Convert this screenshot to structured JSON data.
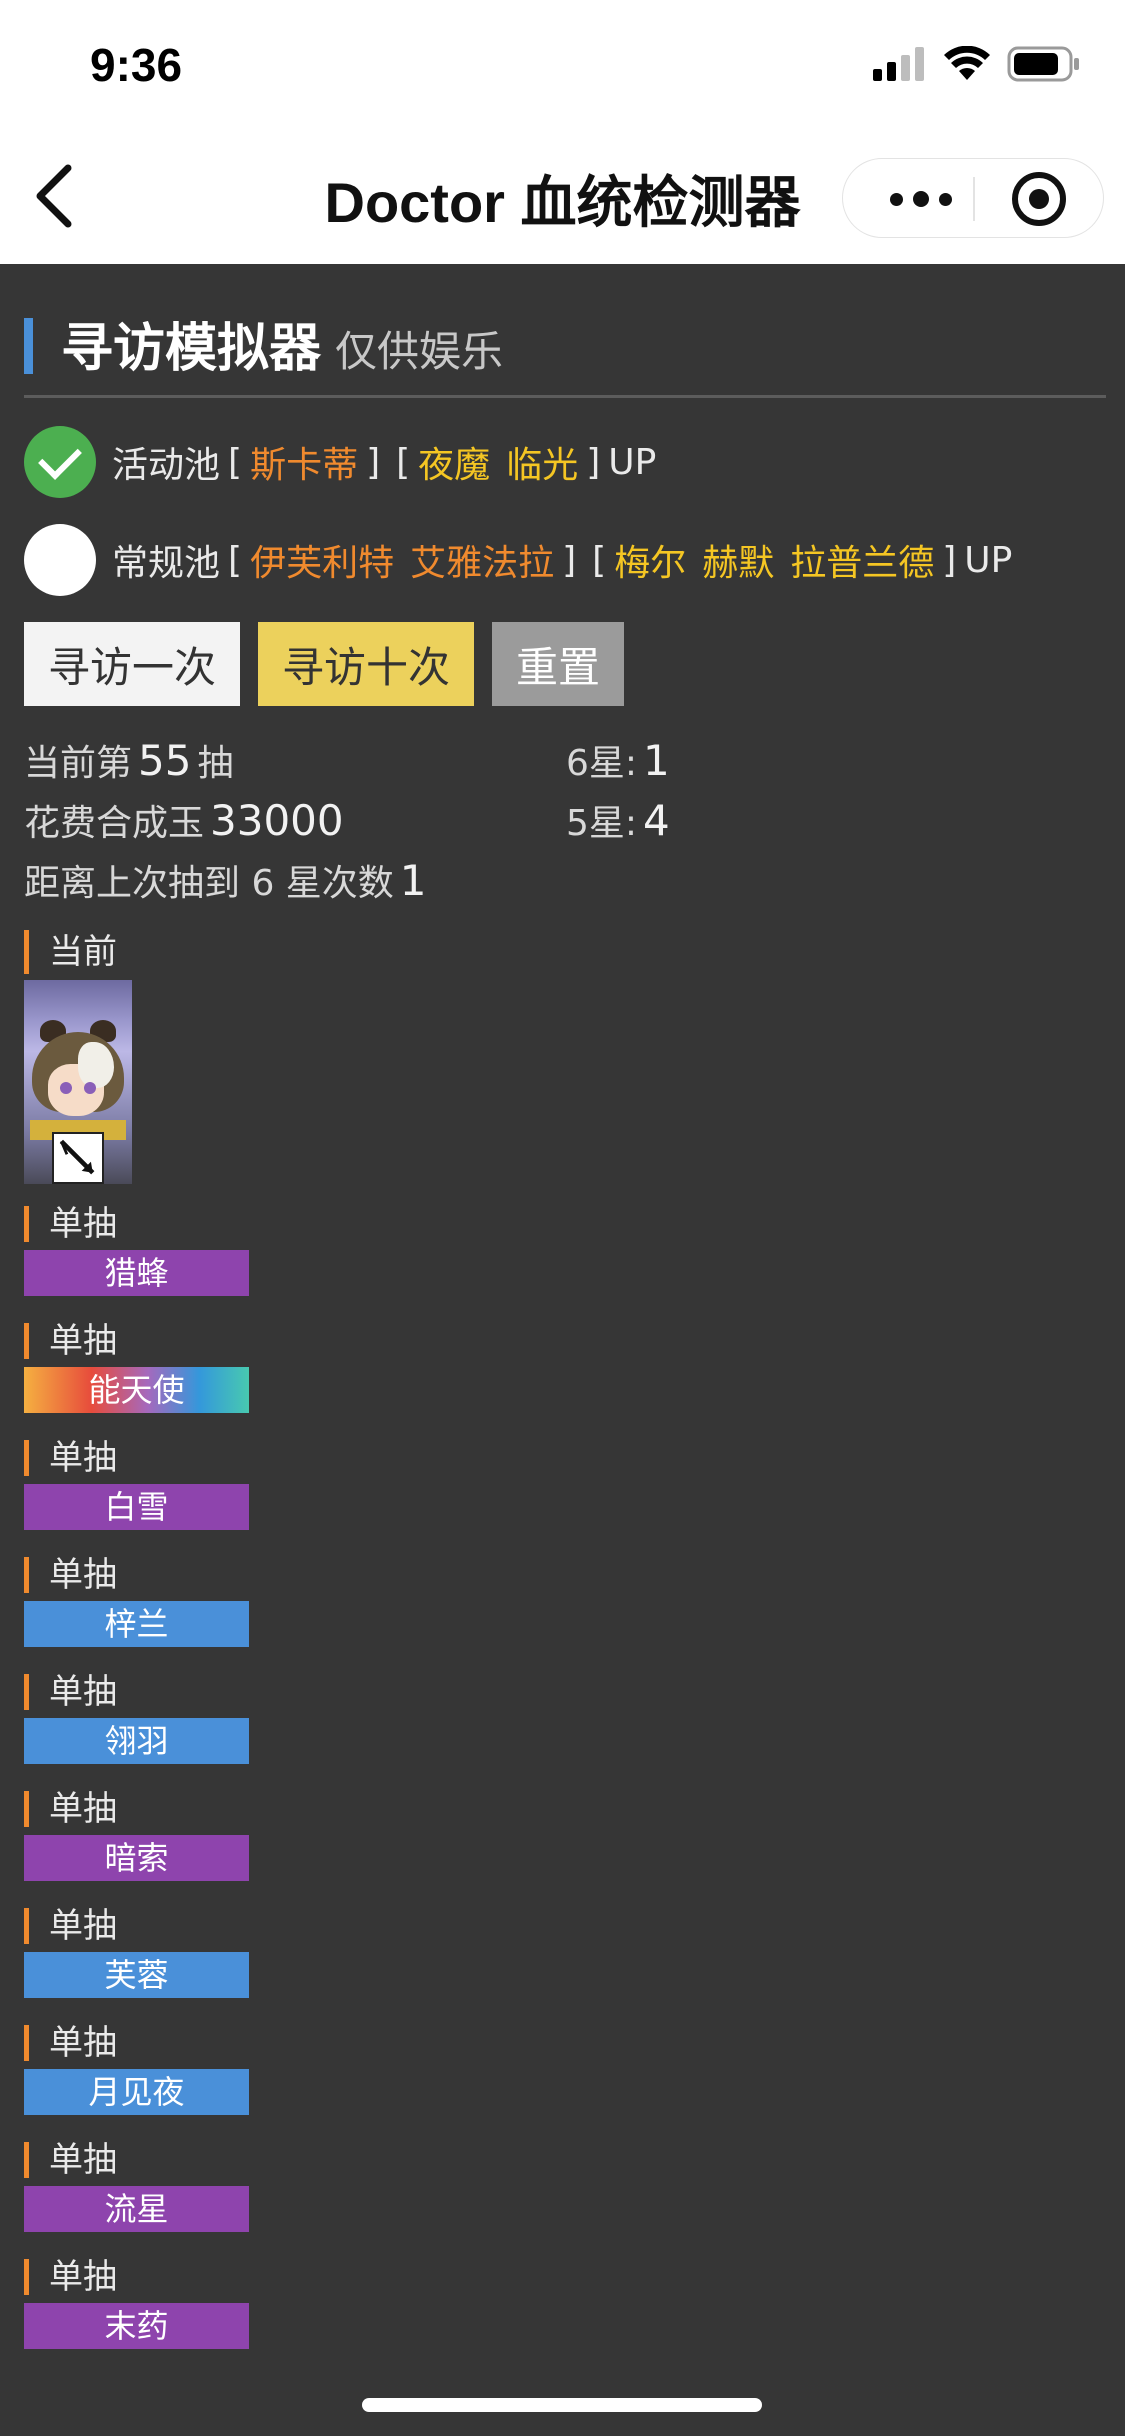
{
  "status_bar": {
    "time": "9:36"
  },
  "nav": {
    "title": "Doctor 血统检测器"
  },
  "section": {
    "title": "寻访模拟器",
    "subtitle": "仅供娱乐"
  },
  "pools": [
    {
      "name": "活动池",
      "selected": true,
      "six_star_up": [
        "斯卡蒂"
      ],
      "five_star_up": [
        "夜魔",
        "临光"
      ],
      "up_label": "UP"
    },
    {
      "name": "常规池",
      "selected": false,
      "six_star_up": [
        "伊芙利特",
        "艾雅法拉"
      ],
      "five_star_up": [
        "梅尔",
        "赫默",
        "拉普兰德"
      ],
      "up_label": "UP"
    }
  ],
  "bracket_open": "[",
  "bracket_close": "]",
  "buttons": {
    "single": "寻访一次",
    "ten": "寻访十次",
    "reset": "重置"
  },
  "stats": {
    "current_prefix": "当前第",
    "current_count": "55",
    "current_suffix": "抽",
    "cost_prefix": "花费合成玉",
    "cost_value": "33000",
    "since_six_prefix": "距离上次抽到 6 星次数",
    "since_six_value": "1",
    "six_star_label": "6星:",
    "six_star_value": "1",
    "five_star_label": "5星:",
    "five_star_value": "4"
  },
  "current": {
    "label": "当前"
  },
  "pull_label": "单抽",
  "pulls": [
    {
      "name": "猎蜂",
      "rarity": "4-star"
    },
    {
      "name": "能天使",
      "rarity": "6-star"
    },
    {
      "name": "白雪",
      "rarity": "4-star"
    },
    {
      "name": "梓兰",
      "rarity": "3-star"
    },
    {
      "name": "翎羽",
      "rarity": "3-star"
    },
    {
      "name": "暗索",
      "rarity": "4-star"
    },
    {
      "name": "芙蓉",
      "rarity": "3-star"
    },
    {
      "name": "月见夜",
      "rarity": "3-star"
    },
    {
      "name": "流星",
      "rarity": "4-star"
    },
    {
      "name": "末药",
      "rarity": "4-star"
    }
  ],
  "colors": {
    "background": "#363636",
    "accent_blue": "#4a90d9",
    "accent_orange": "#f08a2e",
    "operator_yellow": "#f5c623",
    "four_star_purple": "#8e44ad",
    "three_star_blue": "#4a90d9",
    "selected_green": "#4caf50"
  },
  "icons": [
    "back-arrow-icon",
    "more-dots-icon",
    "close-target-icon",
    "signal-icon",
    "wifi-icon",
    "battery-icon",
    "check-icon",
    "class-badge-icon"
  ]
}
